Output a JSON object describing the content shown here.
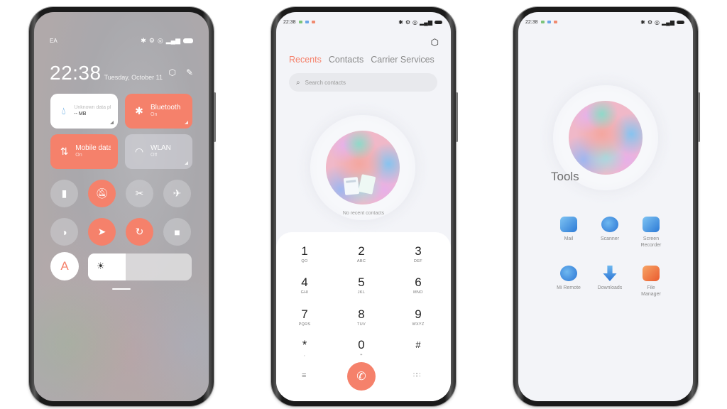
{
  "accent_color": "#f5816b",
  "control_center": {
    "carrier": "EA",
    "status_icons": [
      "bluetooth-icon",
      "vibrate-icon",
      "alarm-icon",
      "signal-icon",
      "battery-icon"
    ],
    "time": "22:38",
    "date": "Tuesday, October 11",
    "tiles": [
      {
        "title": "Unknown data plan",
        "subtitle": "-- MB",
        "state": "info"
      },
      {
        "title": "Bluetooth",
        "subtitle": "On",
        "state": "on"
      },
      {
        "title": "Mobile data",
        "subtitle": "On",
        "state": "on"
      },
      {
        "title": "WLAN",
        "subtitle": "Off",
        "state": "off"
      }
    ],
    "toggles": [
      {
        "name": "flashlight",
        "state": "off"
      },
      {
        "name": "silent",
        "state": "on"
      },
      {
        "name": "screenshot",
        "state": "off"
      },
      {
        "name": "airplane-mode",
        "state": "off"
      },
      {
        "name": "dark-mode",
        "state": "off"
      },
      {
        "name": "location",
        "state": "on"
      },
      {
        "name": "rotation-lock",
        "state": "on"
      },
      {
        "name": "screen-recorder",
        "state": "off"
      }
    ],
    "auto_brightness_label": "A",
    "brightness_percent": 36
  },
  "dialer": {
    "status_time": "22:38",
    "tabs": [
      "Recents",
      "Contacts",
      "Carrier Services"
    ],
    "active_tab": "Recents",
    "search_placeholder": "Search contacts",
    "empty_text": "No recent contacts",
    "keys": [
      {
        "num": "1",
        "letters": "QO"
      },
      {
        "num": "2",
        "letters": "ABC"
      },
      {
        "num": "3",
        "letters": "DEF"
      },
      {
        "num": "4",
        "letters": "GHI"
      },
      {
        "num": "5",
        "letters": "JKL"
      },
      {
        "num": "6",
        "letters": "MNO"
      },
      {
        "num": "7",
        "letters": "PQRS"
      },
      {
        "num": "8",
        "letters": "TUV"
      },
      {
        "num": "9",
        "letters": "WXYZ"
      },
      {
        "num": "*",
        "letters": ","
      },
      {
        "num": "0",
        "letters": "+"
      },
      {
        "num": "#",
        "letters": ""
      }
    ]
  },
  "tools": {
    "status_time": "22:38",
    "folder_title": "Tools",
    "apps": [
      {
        "label": "Mail",
        "icon": "mail-icon"
      },
      {
        "label": "Scanner",
        "icon": "scanner-icon"
      },
      {
        "label": "Screen Recorder",
        "icon": "screen-recorder-icon"
      },
      {
        "label": "Mi Remote",
        "icon": "mi-remote-icon"
      },
      {
        "label": "Downloads",
        "icon": "downloads-icon"
      },
      {
        "label": "File Manager",
        "icon": "file-manager-icon"
      }
    ]
  }
}
